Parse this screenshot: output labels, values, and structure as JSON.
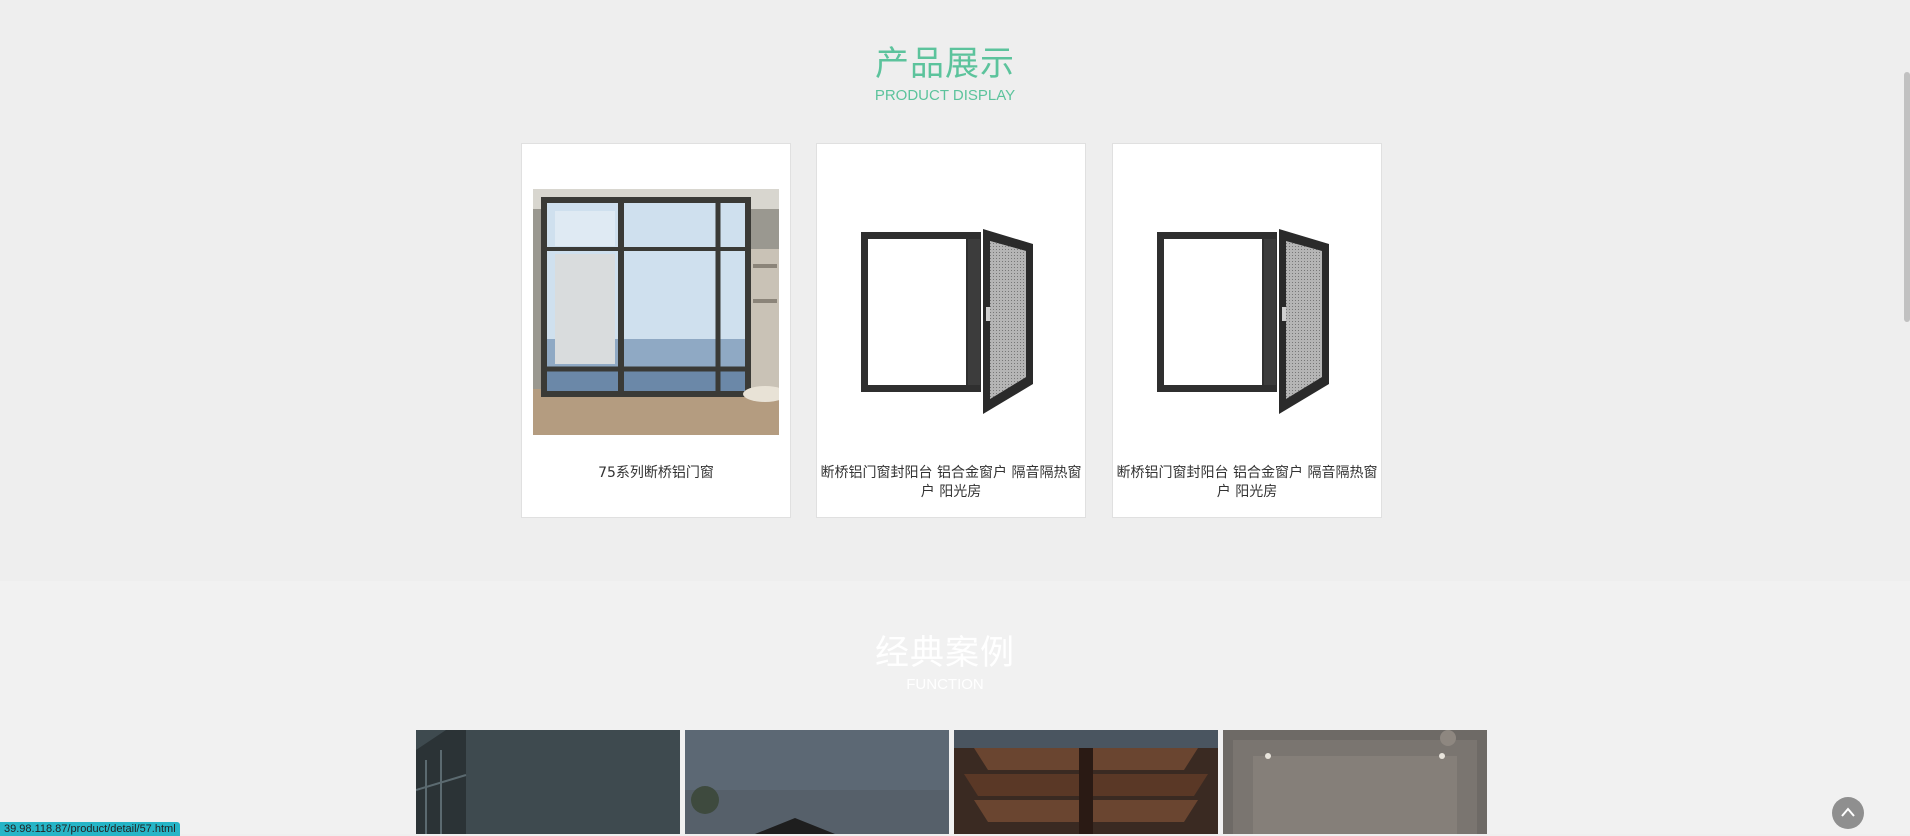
{
  "products_section": {
    "title_cn": "产品展示",
    "title_en": "PRODUCT DISPLAY",
    "items": [
      {
        "caption": "75系列断桥铝门窗",
        "image": "room-window-photo"
      },
      {
        "caption": "断桥铝门窗封阳台 铝合金窗户 隔音隔热窗户 阳光房",
        "image": "casement-window-with-screen"
      },
      {
        "caption": "断桥铝门窗封阳台 铝合金窗户 隔音隔热窗户 阳光房",
        "image": "casement-window-with-screen"
      }
    ]
  },
  "cases_section": {
    "title_cn": "经典案例",
    "title_en": "FUNCTION",
    "tiles": [
      "glass-building-photo",
      "house-roof-photo",
      "spiral-building-photo",
      "ceiling-interior-photo"
    ]
  },
  "status_bar": {
    "url": "39.98.118.87/product/detail/57.html"
  },
  "icons": {
    "back_to_top": "chevron-up-icon"
  },
  "colors": {
    "accent": "#5cc39c",
    "status_bar": "#26b5c7"
  }
}
